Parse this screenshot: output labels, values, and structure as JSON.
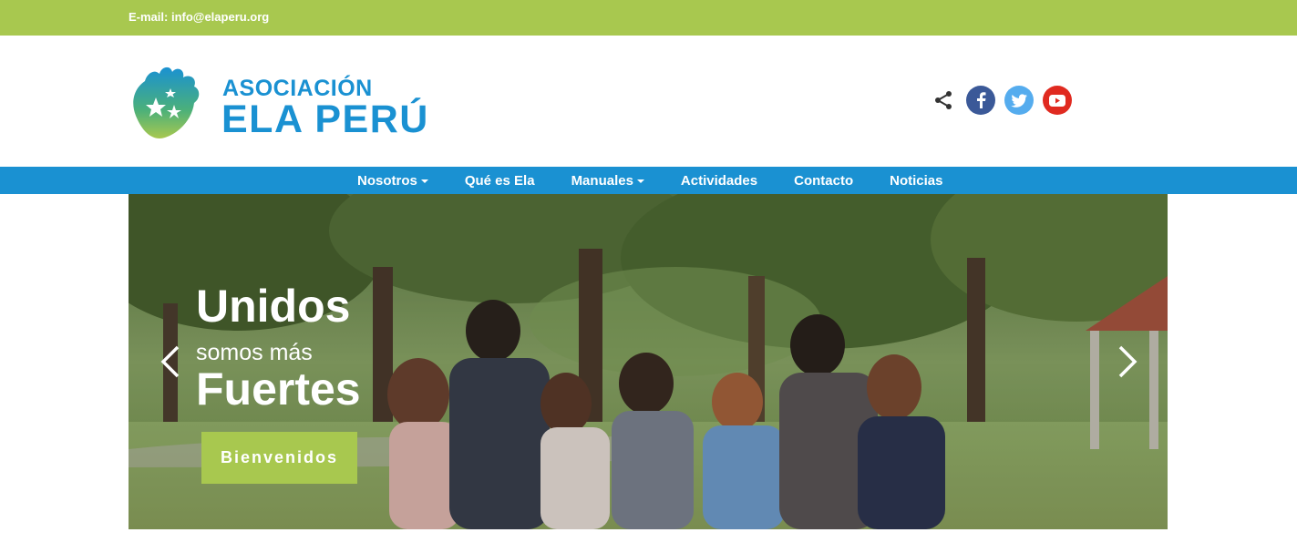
{
  "topbar": {
    "email": "E-mail: info@elaperu.org"
  },
  "logo": {
    "line1": "ASOCIACIÓN",
    "line2": "ELA PERÚ"
  },
  "social": [
    {
      "name": "share-icon",
      "glyph": "share",
      "color": "#333333"
    },
    {
      "name": "facebook-icon",
      "glyph": "f",
      "color": "#3b5998"
    },
    {
      "name": "twitter-icon",
      "glyph": "t",
      "color": "#55acee"
    },
    {
      "name": "youtube-icon",
      "glyph": "▶",
      "color": "#e02a20"
    }
  ],
  "nav": {
    "items": [
      {
        "label": "Nosotros",
        "dropdown": true
      },
      {
        "label": "Qué es Ela",
        "dropdown": false
      },
      {
        "label": "Manuales",
        "dropdown": true
      },
      {
        "label": "Actividades",
        "dropdown": false
      },
      {
        "label": "Contacto",
        "dropdown": false
      },
      {
        "label": "Noticias",
        "dropdown": false
      }
    ]
  },
  "hero": {
    "title1": "Unidos",
    "title2": "somos más",
    "title3": "Fuertes",
    "button": "Bienvenidos"
  },
  "colors": {
    "green": "#a8c84f",
    "blue": "#1a91d2"
  }
}
